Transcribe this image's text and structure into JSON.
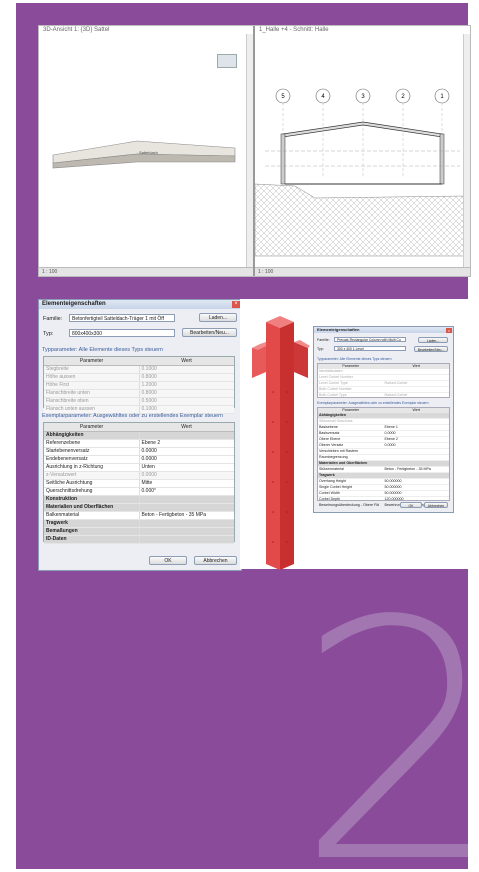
{
  "page": {
    "big_number": "2"
  },
  "top_screenshot": {
    "left_view_title": "3D-Ansicht 1: {3D} Sattel",
    "right_view_title": "1_Halle +4 - Schnitt: Halle",
    "beam_label": "Satteldach",
    "axes": [
      "5",
      "4",
      "3",
      "2",
      "1"
    ],
    "status_scale": "1 : 100"
  },
  "dialog": {
    "title": "Elementeigenschaften",
    "family_label": "Familie:",
    "family_value": "Betonfertigteil Satteldach-Träger 1 mit Öff",
    "load_button": "Laden...",
    "type_label": "Typ:",
    "type_value": "800x400x300",
    "edit_button": "Bearbeiten/Neu...",
    "type_params_header": "Typparameter: Alle Elemente dieses Typs steuern",
    "col_param": "Parameter",
    "col_value": "Wert",
    "type_params": [
      [
        "Stegbreite",
        "0.1000"
      ],
      [
        "Höhe aussen",
        "0.8000"
      ],
      [
        "Höhe First",
        "1.2000"
      ],
      [
        "Flanschbreite unten",
        "0.8000"
      ],
      [
        "Flanschbreite oben",
        "0.5000"
      ],
      [
        "Flansch unten aussen",
        "0.1000"
      ]
    ],
    "instance_params_header": "Exemplarparameter: Ausgewähltes oder zu erstellendes Exemplar steuern",
    "instance_params": [
      {
        "group": "Abhängigkeiten"
      },
      [
        "Referenzebene",
        "Ebene 2"
      ],
      [
        "Startebenenversatz",
        "0.0000"
      ],
      [
        "Endebenenversatz",
        "0.0000"
      ],
      [
        "Ausrichtung in z-Richtung",
        "Unten"
      ],
      [
        "z-Versatzwert",
        "0.0000"
      ],
      [
        "Seitliche Ausrichtung",
        "Mitte"
      ],
      [
        "Querschnittsdrehung",
        "0.000°"
      ],
      {
        "group": "Konstruktion"
      },
      {
        "group": "Materialien und Oberflächen"
      },
      [
        "Balkenmaterial",
        "Beton - Fertigbeton - 35 MPa"
      ],
      {
        "group": "Tragwerk"
      },
      {
        "group": "Bemaßungen"
      },
      {
        "group": "ID-Daten"
      }
    ],
    "ok_button": "OK",
    "cancel_button": "Abbrechen"
  },
  "dialog_small": {
    "title": "Elementeigenschaften",
    "family_label": "Familie:",
    "family_value": "Precast-Rectangular Column with Multi Co",
    "load_button": "Laden...",
    "type_label": "Typ:",
    "type_value": "300 x 400 1 Level",
    "edit_button": "Bearbeiten/Neu...",
    "type_params_header": "Typparameter: Alle Elemente dieses Typs steuern",
    "col_param": "Parameter",
    "col_value": "Wert",
    "type_params": [
      [
        "Identitätsdaten",
        ""
      ],
      [
        "Level Corbel Number",
        ""
      ],
      [
        "Level Corbel Type",
        "Raised Corbel"
      ],
      [
        "Both Corbel Number",
        ""
      ],
      [
        "Both Corbel Type",
        "Raised Corbel"
      ]
    ],
    "instance_params_header": "Exemplarparameter: Ausgewähltes oder zu erstellendes Exemplar steuern",
    "instance_params": [
      {
        "group": "Abhängigkeiten"
      },
      [
        "Stützenstil Geschoss",
        ""
      ],
      [
        "Basisebene",
        "Ebene 1"
      ],
      [
        "Basisversatz",
        "0.0000"
      ],
      [
        "Obere Ebene",
        "Ebene 2"
      ],
      [
        "Oberer Versatz",
        "0.0000"
      ],
      [
        "Verschieben mit Rastern",
        ""
      ],
      [
        "Raumbegrenzung",
        ""
      ],
      {
        "group": "Materialien und Oberflächen"
      },
      [
        "Stützenmaterial",
        "Beton - Fertigbeton - 35 MPa"
      ],
      {
        "group": "Tragwerk"
      },
      [
        "Overhang Height",
        "50.000000"
      ],
      [
        "Single Corbel Height",
        "50.000000"
      ],
      [
        "Corbel Width",
        "50.000000"
      ],
      [
        "Corbel Depth",
        "120.000000"
      ],
      [
        "Bewehrungsüberdeckung - Obere Flä",
        "Bewehrungsüberdeckung 1 <0.025"
      ]
    ],
    "ok_button": "OK",
    "cancel_button": "Abbrechen"
  }
}
